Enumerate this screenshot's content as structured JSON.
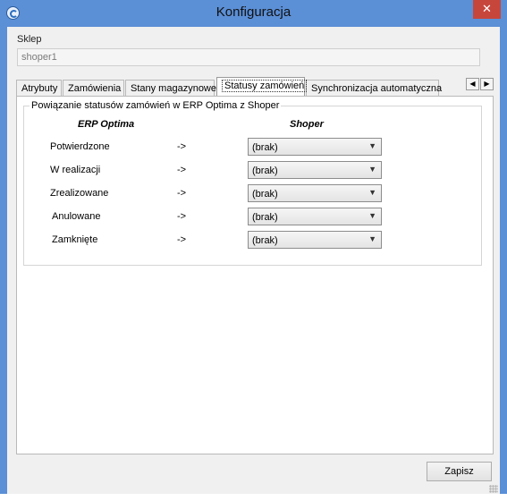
{
  "window": {
    "title": "Konfiguracja",
    "close_glyph": "✕",
    "icon": "app-refresh-icon",
    "accent_color": "#5b8fd6",
    "close_color": "#c7463c"
  },
  "shop": {
    "label": "Sklep",
    "value": "shoper1"
  },
  "tabs": [
    {
      "label": "Atrybuty"
    },
    {
      "label": "Zamówienia"
    },
    {
      "label": "Stany magazynowe"
    },
    {
      "label": "Statusy zamówień"
    },
    {
      "label": "Synchronizacja automatyczna"
    }
  ],
  "active_tab": "Statusy zamówień",
  "tab_scroll": {
    "left": "◀",
    "right": "▶"
  },
  "mapping": {
    "group_title": "Powiązanie statusów zamówień w ERP Optima z Shoper",
    "col_left": "ERP Optima",
    "col_right": "Shoper",
    "arrow": "->",
    "rows": [
      {
        "status": "Potwierdzone",
        "value": "(brak)"
      },
      {
        "status": "W realizacji",
        "value": "(brak)"
      },
      {
        "status": "Zrealizowane",
        "value": "(brak)"
      },
      {
        "status": "Anulowane",
        "value": "(brak)"
      },
      {
        "status": "Zamknięte",
        "value": "(brak)"
      }
    ]
  },
  "footer": {
    "save_label": "Zapisz"
  }
}
